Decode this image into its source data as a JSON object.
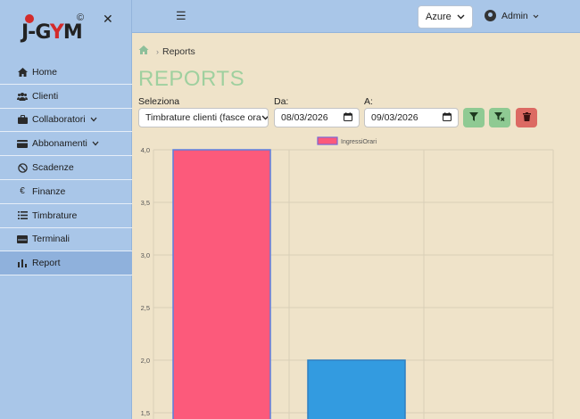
{
  "brand": {
    "logo_text_1": "J-G",
    "logo_text_2": "Y",
    "logo_text_3": "M",
    "copyright": "©"
  },
  "sidebar": {
    "items": [
      {
        "label": "Home",
        "icon": "home-icon"
      },
      {
        "label": "Clienti",
        "icon": "users-icon"
      },
      {
        "label": "Collaboratori",
        "icon": "briefcase-icon",
        "has_submenu": true
      },
      {
        "label": "Abbonamenti",
        "icon": "card-icon",
        "has_submenu": true
      },
      {
        "label": "Scadenze",
        "icon": "ban-icon"
      },
      {
        "label": "Finanze",
        "icon": "euro-icon"
      },
      {
        "label": "Timbrature",
        "icon": "list-icon"
      },
      {
        "label": "Terminali",
        "icon": "terminal-icon"
      },
      {
        "label": "Report",
        "icon": "chart-bar-icon",
        "active": true
      }
    ]
  },
  "header": {
    "theme_value": "Azure",
    "user_name": "Admin"
  },
  "breadcrumb": {
    "current": "Reports"
  },
  "page": {
    "title": "REPORTS"
  },
  "filters": {
    "select_label": "Seleziona",
    "select_value": "Timbrature clienti (fasce ora",
    "from_label": "Da:",
    "from_value": "08/03/2026",
    "to_label": "A:",
    "to_value": "09/03/2026"
  },
  "colors": {
    "bar1": "#fc5a7b",
    "bar2": "#339be0",
    "accent_green": "#8fca93",
    "danger": "#dc6a63"
  },
  "chart_data": {
    "type": "bar",
    "categories": [
      "",
      ""
    ],
    "series": [
      {
        "name": "IngressiOrari",
        "values": [
          4,
          2
        ]
      }
    ],
    "ylim": [
      1.5,
      4
    ],
    "yticks": [
      "4,0",
      "3,5",
      "3,0",
      "2,5",
      "2,0",
      "1,5"
    ],
    "grid": true,
    "legend": "top"
  }
}
